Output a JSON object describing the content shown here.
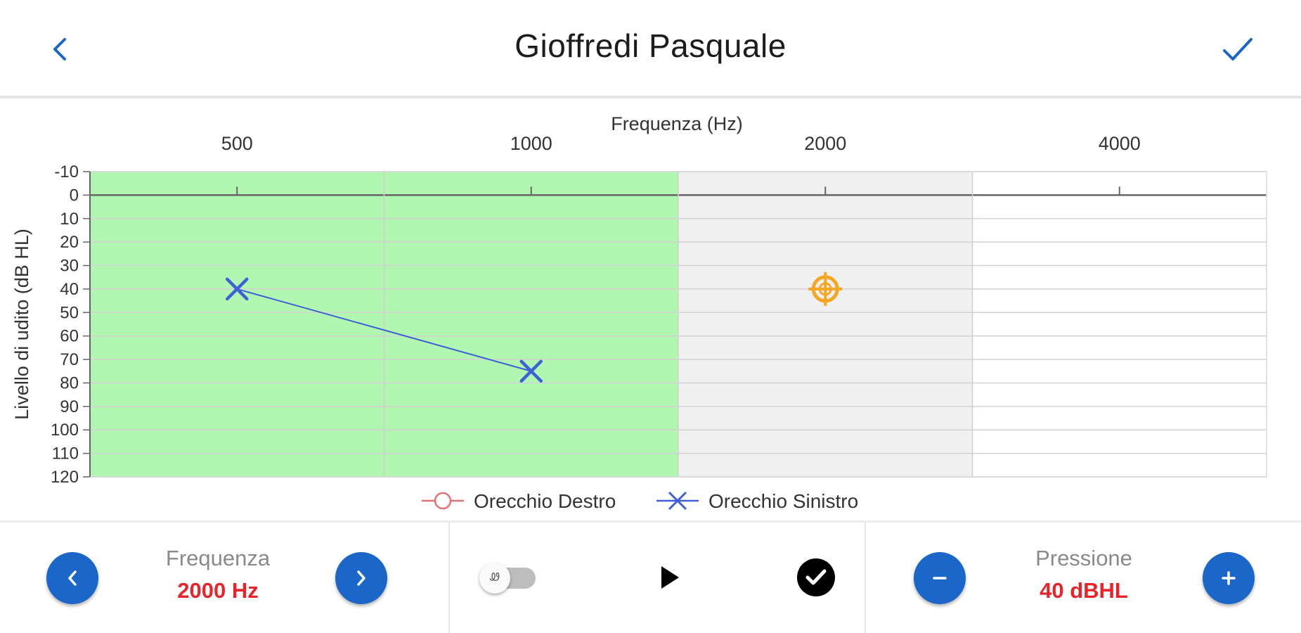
{
  "header": {
    "title": "Gioffredi Pasquale",
    "back_icon": "chevron-left-icon",
    "confirm_icon": "checkmark-icon",
    "accent_color": "#1a67c9"
  },
  "chart_data": {
    "type": "line",
    "title": "",
    "xlabel": "Frequenza (Hz)",
    "ylabel": "Livello di udito (dB HL)",
    "x_categories": [
      "500",
      "1000",
      "2000",
      "4000"
    ],
    "y_ticks": [
      -10,
      0,
      10,
      20,
      30,
      40,
      50,
      60,
      70,
      80,
      90,
      100,
      110,
      120
    ],
    "ylim": [
      -10,
      120
    ],
    "y_inverted": true,
    "x_axis_position": "top",
    "grid": true,
    "legend_position": "bottom",
    "series": [
      {
        "name": "Orecchio Destro",
        "color": "#e57373",
        "marker": "circle",
        "points": []
      },
      {
        "name": "Orecchio Sinistro",
        "color": "#3f5fd6",
        "marker": "x",
        "points": [
          {
            "x": "500",
            "y": 40
          },
          {
            "x": "1000",
            "y": 75
          }
        ]
      }
    ],
    "current_point": {
      "x": "2000",
      "y": 40,
      "color": "#f5a623"
    },
    "band_colors": {
      "tested": "#b1f7b1",
      "current": "#f0f0f0",
      "untested": "#ffffff"
    }
  },
  "controls": {
    "frequency": {
      "label": "Frequenza",
      "value": "2000 Hz",
      "prev_icon": "chevron-left-icon",
      "next_icon": "chevron-right-icon"
    },
    "pressure": {
      "label": "Pressione",
      "value": "40 dBHL",
      "minus_icon": "minus-icon",
      "plus_icon": "plus-icon"
    },
    "toggle_icon": "ear-icon",
    "toggle_glyph": "Ꮺ",
    "play_icon": "play-icon",
    "check_icon": "check-circle-icon"
  }
}
